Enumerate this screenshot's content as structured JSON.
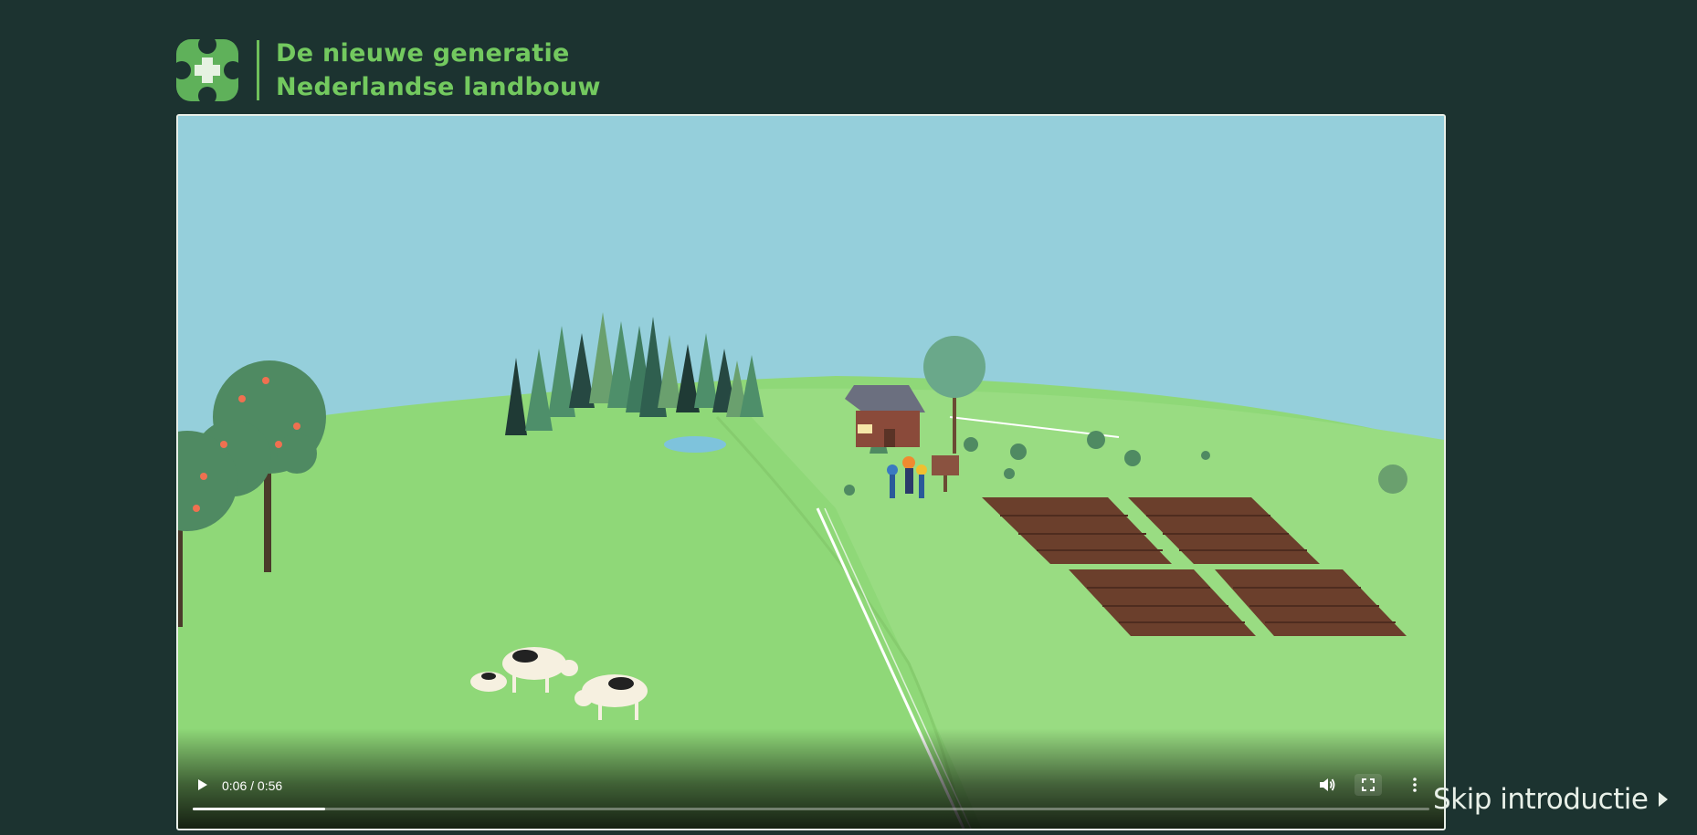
{
  "header": {
    "title_line1": "De nieuwe generatie",
    "title_line2": "Nederlandse landbouw",
    "logo_icon": "clover-cross-icon"
  },
  "video": {
    "current_time": "0:06",
    "duration": "0:56",
    "time_display": "0:06 / 0:56",
    "progress_fraction": 0.107,
    "icons": {
      "play": "play-icon",
      "volume": "volume-icon",
      "fullscreen": "fullscreen-icon",
      "more": "more-options-icon"
    }
  },
  "skip": {
    "label": "Skip introductie"
  },
  "colors": {
    "background": "#1c3330",
    "accent_green": "#73c95f",
    "sky": "#95cfdb",
    "grass": "#8fd878"
  }
}
